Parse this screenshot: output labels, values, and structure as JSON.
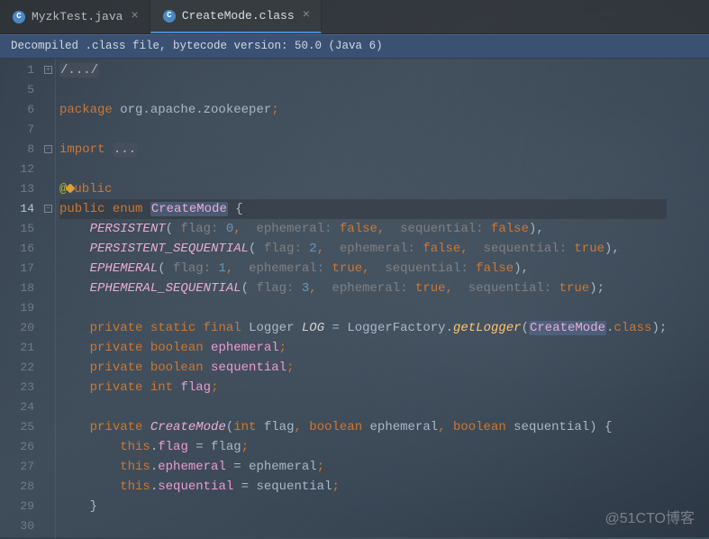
{
  "tabs": [
    {
      "label": "MyzkTest.java",
      "iconLetter": "C"
    },
    {
      "label": "CreateMode.class",
      "iconLetter": "C"
    }
  ],
  "notice": "Decompiled .class file, bytecode version: 50.0 (Java 6)",
  "gutter": [
    "1",
    "5",
    "6",
    "7",
    "8",
    "12",
    "13",
    "14",
    "15",
    "16",
    "17",
    "18",
    "19",
    "20",
    "21",
    "22",
    "23",
    "24",
    "25",
    "26",
    "27",
    "28",
    "29",
    "30"
  ],
  "currentGutterIndex": 7,
  "fold": {
    "positions": [
      0,
      4,
      7
    ],
    "symbol": "−",
    "plusSymbol": "+"
  },
  "code": {
    "pkg": {
      "kw": "package",
      "path": "org.apache.zookeeper",
      "semi": ";"
    },
    "imp": {
      "kw": "import",
      "ellipsis": "..."
    },
    "ann": {
      "at": "@",
      "word": "ublic",
      "iconName": "override-icon"
    },
    "decl": {
      "pub": "public",
      "enm": "enum",
      "name": "CreateMode",
      "brace": "{"
    },
    "consts": [
      {
        "name": "PERSISTENT",
        "flag": "0",
        "eph": "false",
        "seq": "false",
        "trail": "),"
      },
      {
        "name": "PERSISTENT_SEQUENTIAL",
        "flag": "2",
        "eph": "false",
        "seq": "true",
        "trail": "),"
      },
      {
        "name": "EPHEMERAL",
        "flag": "1",
        "eph": "true",
        "seq": "false",
        "trail": "),"
      },
      {
        "name": "EPHEMERAL_SEQUENTIAL",
        "flag": "3",
        "eph": "true",
        "seq": "true",
        "trail": ");"
      }
    ],
    "paramLabels": {
      "flag": "flag:",
      "eph": "ephemeral:",
      "seq": "sequential:"
    },
    "log": {
      "priv": "private",
      "stat": "static",
      "fin": "final",
      "type": "Logger",
      "var": "LOG",
      "eq": "=",
      "factory": "LoggerFactory",
      "dot": ".",
      "call": "getLogger",
      "open": "(",
      "arg": "CreateMode",
      "dot2": ".",
      "cls": "class",
      "close": ");"
    },
    "fields": [
      {
        "priv": "private",
        "type": "boolean",
        "name": "ephemeral"
      },
      {
        "priv": "private",
        "type": "boolean",
        "name": "sequential"
      },
      {
        "priv": "private",
        "type": "int",
        "name": "flag"
      }
    ],
    "ctor": {
      "priv": "private",
      "name": "CreateMode",
      "open": "(",
      "p1t": "int",
      "p1n": "flag",
      "p2t": "boolean",
      "p2n": "ephemeral",
      "p3t": "boolean",
      "p3n": "sequential",
      "close": ") {"
    },
    "assigns": [
      {
        "this": "this",
        "field": "flag",
        "rhs": "flag"
      },
      {
        "this": "this",
        "field": "ephemeral",
        "rhs": "ephemeral"
      },
      {
        "this": "this",
        "field": "sequential",
        "rhs": "sequential"
      }
    ],
    "closeBrace": "}",
    "foldedTop": "/.../"
  },
  "watermark": "@51CTO博客"
}
